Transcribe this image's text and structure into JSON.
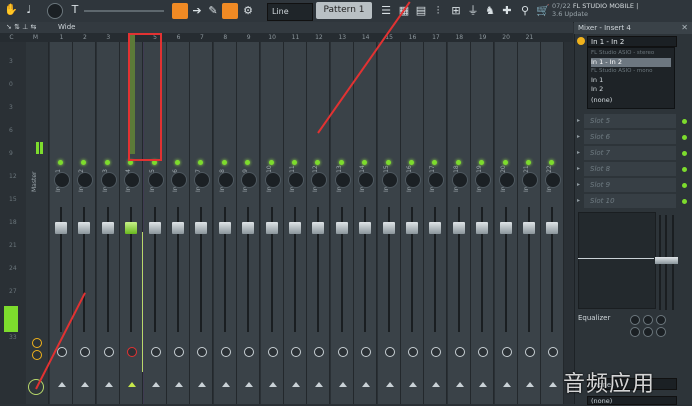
{
  "toolbar": {
    "line_mode": "Line",
    "pattern": "Pattern 1",
    "news_date": "07/22",
    "news_title": "FL STUDIO MOBILE |",
    "news_sub": "3.6 Update"
  },
  "mixer": {
    "view_label": "Wide",
    "col_labels": [
      "C",
      "M",
      "1",
      "2",
      "3",
      "4",
      "5",
      "6",
      "7",
      "8",
      "9",
      "10",
      "11",
      "12",
      "13",
      "14",
      "15",
      "16",
      "17",
      "18",
      "19",
      "20",
      "21"
    ],
    "db_scale": [
      "3",
      "0",
      "3",
      "6",
      "9",
      "12",
      "15",
      "18",
      "21",
      "24",
      "27",
      "30",
      "33"
    ],
    "master_label": "Master",
    "inserts": [
      "Insert 1",
      "Insert 2",
      "Insert 3",
      "Insert 4",
      "Insert 5",
      "Insert 6",
      "Insert 7",
      "Insert 8",
      "Insert 9",
      "Insert 10",
      "Insert 11",
      "Insert 12",
      "Insert 13",
      "Insert 14",
      "Insert 15",
      "Insert 16",
      "Insert 17",
      "Insert 18",
      "Insert 19",
      "Insert 20",
      "Insert 21",
      "Insert 22"
    ]
  },
  "panel": {
    "title": "Mixer - Insert 4",
    "input_value": "In 1 - In 2",
    "dropdown": {
      "header1": "FL Studio ASIO - stereo",
      "item_selected": "In 1 - In 2",
      "header2": "FL Studio ASIO - mono",
      "item_in1": "In 1",
      "item_in2": "In 2",
      "item_none": "(none)"
    },
    "slots": [
      "Slot 5",
      "Slot 6",
      "Slot 7",
      "Slot 8",
      "Slot 9",
      "Slot 10"
    ],
    "eq_label": "Equalizer",
    "output_value": "(none)",
    "output_value2": "(none)"
  },
  "watermark": "音频应用"
}
